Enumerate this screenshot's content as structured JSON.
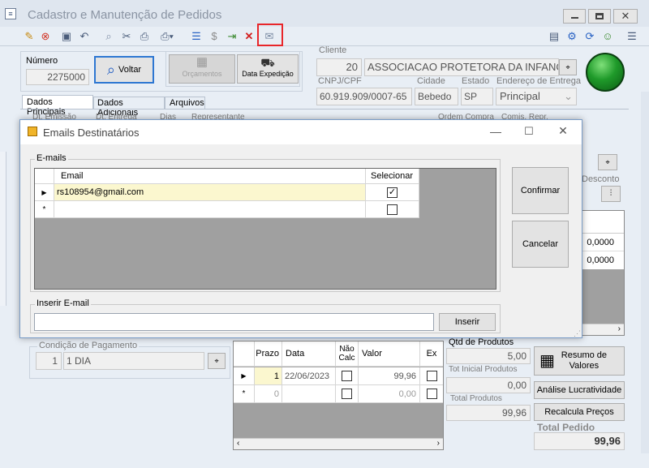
{
  "window": {
    "title": "Cadastro e Manutenção de Pedidos"
  },
  "header": {
    "numero_label": "Número",
    "numero_value": "2275000",
    "voltar_label": "Voltar",
    "orcamentos_label": "Orçamentos",
    "data_expedicao_label": "Data Expedição",
    "cliente_label": "Cliente",
    "cliente_code": "20",
    "cliente_name": "ASSOCIACAO PROTETORA DA INFANC",
    "cnpj_label": "CNPJ/CPF",
    "cnpj_value": "60.919.909/0007-65",
    "cidade_label": "Cidade",
    "cidade_value": "Bebedo",
    "estado_label": "Estado",
    "estado_value": "SP",
    "endereco_label": "Endereço de Entrega",
    "endereco_value": "Principal"
  },
  "tabs": [
    "Dados Principais",
    "Dados Adicionais",
    "Arquivos"
  ],
  "main_columns": {
    "dt_emissao": "Dt. Emissão",
    "dt_entrega": "Dt. Entrega",
    "dias": "Dias",
    "representante": "Representante",
    "ordem_compra": "Ordem Compra",
    "comis_repr": "Comis. Repr."
  },
  "right_panel": {
    "desconto_label": "Desconto",
    "value1": "0,0000",
    "value2": "0,0000"
  },
  "condicao": {
    "label": "Condição de Pagamento",
    "code": "1",
    "value": "1 DIA"
  },
  "installments": {
    "headers": {
      "prazo": "Prazo",
      "data": "Data",
      "nao_calc": "Não Calc",
      "valor": "Valor",
      "ex": "Ex"
    },
    "rows": [
      {
        "prazo": "1",
        "data": "22/06/2023",
        "valor": "99,96"
      },
      {
        "prazo": "0",
        "data": "",
        "valor": "0,00"
      }
    ]
  },
  "totals": {
    "qtd_produtos_label": "Qtd de Produtos",
    "qtd_produtos_value": "5,00",
    "tot_inicial_label": "Tot Inicial Produtos",
    "tot_inicial_value": "0,00",
    "total_produtos_label": "Total Produtos",
    "total_produtos_value": "99,96",
    "total_pedido_label": "Total Pedido",
    "total_pedido_value": "99,96",
    "resumo_label": "Resumo de Valores",
    "analise_label": "Análise Lucratividade",
    "recalcula_label": "Recalcula Preços"
  },
  "dialog": {
    "title": "Emails Destinatários",
    "group_label": "E-mails",
    "col_email": "Email",
    "col_selecionar": "Selecionar",
    "rows": [
      {
        "email": "rs108954@gmail.com",
        "selected": true
      }
    ],
    "confirmar_label": "Confirmar",
    "cancelar_label": "Cancelar",
    "inserir_group_label": "Inserir E-mail",
    "inserir_button_label": "Inserir",
    "inserir_value": ""
  },
  "colors": {
    "highlight": "#e8262a",
    "selected_row": "#fbf7cf",
    "grid_bg": "#a0a0a0"
  }
}
